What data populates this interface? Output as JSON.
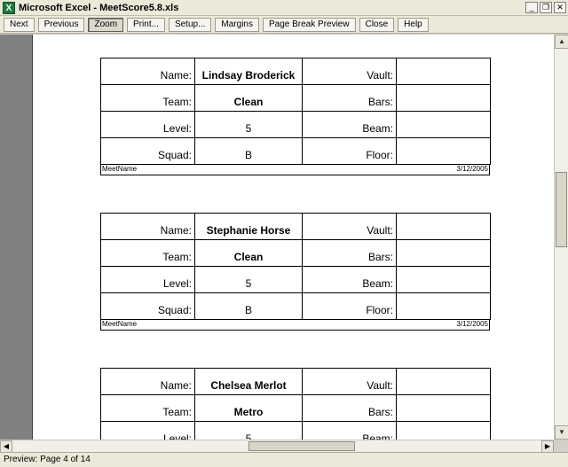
{
  "window": {
    "title": "Microsoft Excel - MeetScore5.8.xls",
    "icon": "excel-icon",
    "controls": {
      "minimize": "_",
      "restore": "❐",
      "close": "✕"
    }
  },
  "toolbar": {
    "next": "Next",
    "previous": "Previous",
    "zoom": "Zoom",
    "print": "Print...",
    "setup": "Setup...",
    "margins": "Margins",
    "page_break_preview": "Page Break Preview",
    "close": "Close",
    "help": "Help"
  },
  "labels": {
    "name": "Name:",
    "team": "Team:",
    "level": "Level:",
    "squad": "Squad:",
    "vault": "Vault:",
    "bars": "Bars:",
    "beam": "Beam:",
    "floor": "Floor:"
  },
  "cards": [
    {
      "name": "Lindsay Broderick",
      "team": "Clean",
      "level": "5",
      "squad": "B",
      "footer_left": "MeetName",
      "footer_right": "3/12/2005"
    },
    {
      "name": "Stephanie Horse",
      "team": "Clean",
      "level": "5",
      "squad": "B",
      "footer_left": "MeetName",
      "footer_right": "3/12/2005"
    },
    {
      "name": "Chelsea Merlot",
      "team": "Metro",
      "level": "5"
    }
  ],
  "status": {
    "text": "Preview: Page 4 of 14"
  }
}
